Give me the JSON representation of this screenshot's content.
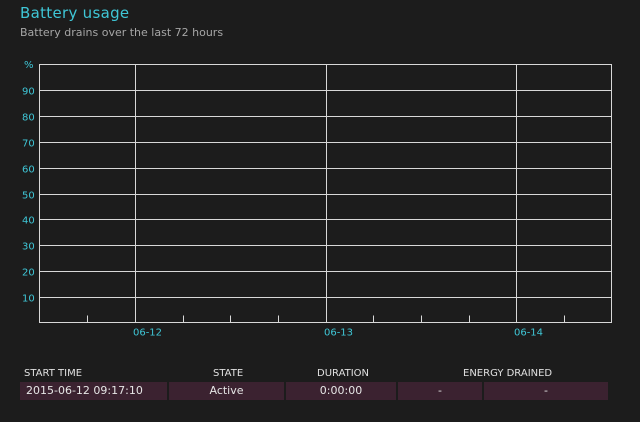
{
  "header": {
    "title": "Battery usage",
    "subtitle": "Battery drains over the last 72 hours"
  },
  "chart_data": {
    "type": "line",
    "ylabel": "%",
    "ylim": [
      0,
      100
    ],
    "y_ticks": [
      10,
      20,
      30,
      40,
      50,
      60,
      70,
      80,
      90
    ],
    "x_labels": [
      "06-12",
      "06-13",
      "06-14"
    ],
    "grid": true,
    "series": []
  },
  "colors": {
    "accent": "#3fc6d6",
    "row_bg": "#3b2230",
    "grid": "#d8d8d8"
  },
  "table": {
    "columns": [
      "START TIME",
      "STATE",
      "DURATION",
      "ENERGY DRAINED"
    ],
    "rows": [
      {
        "start_time": "2015-06-12  09:17:10",
        "state": "Active",
        "duration": "0:00:00",
        "energy_pct": "-",
        "energy_mwh": "-"
      }
    ]
  }
}
